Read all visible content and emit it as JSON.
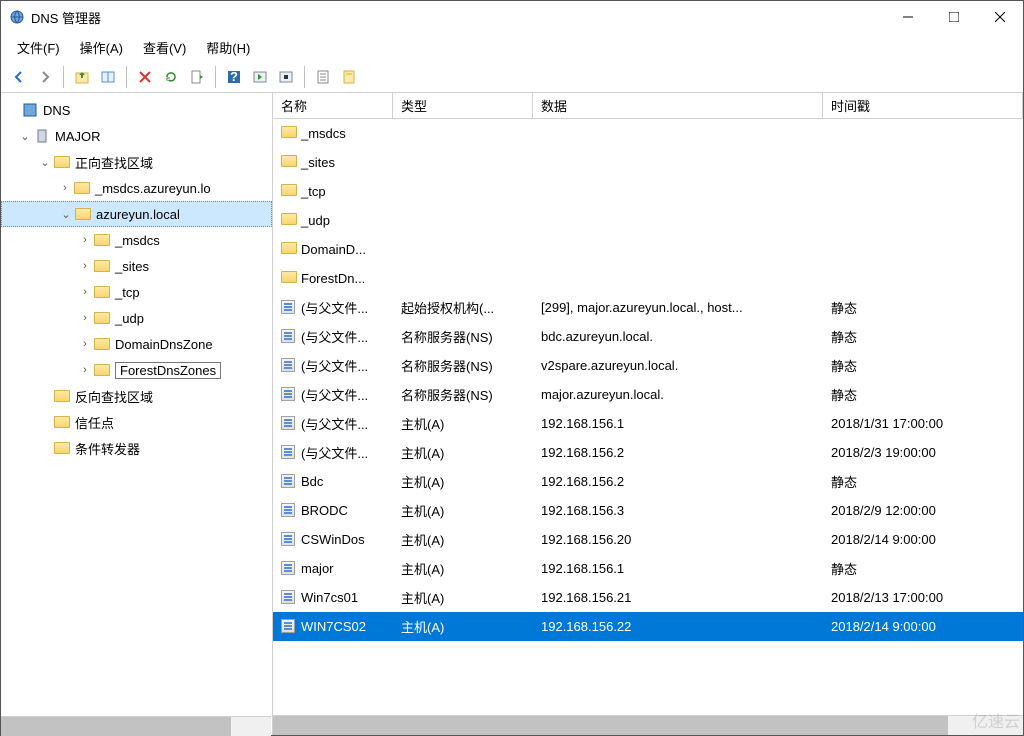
{
  "window": {
    "title": "DNS 管理器"
  },
  "menus": {
    "file": "文件(F)",
    "action": "操作(A)",
    "view": "查看(V)",
    "help": "帮助(H)"
  },
  "tree": {
    "root": "DNS",
    "server": "MAJOR",
    "fwd_zone": "正向查找区域",
    "rev_zone": "反向查找区域",
    "trust": "信任点",
    "cond_fwd": "条件转发器",
    "zone_msdcs": "_msdcs.azureyun.lo",
    "zone_local": "azureyun.local",
    "sub_msdcs": "_msdcs",
    "sub_sites": "_sites",
    "sub_tcp": "_tcp",
    "sub_udp": "_udp",
    "sub_domaindns": "DomainDnsZone",
    "sub_forestdns": "ForestDnsZones"
  },
  "columns": {
    "name": "名称",
    "type": "类型",
    "data": "数据",
    "ts": "时间戳"
  },
  "col_widths": {
    "name": "120px",
    "type": "140px",
    "data": "290px",
    "ts": "200px"
  },
  "rows": [
    {
      "icon": "folder",
      "name": "_msdcs",
      "type": "",
      "data": "",
      "ts": ""
    },
    {
      "icon": "folder",
      "name": "_sites",
      "type": "",
      "data": "",
      "ts": ""
    },
    {
      "icon": "folder",
      "name": "_tcp",
      "type": "",
      "data": "",
      "ts": ""
    },
    {
      "icon": "folder",
      "name": "_udp",
      "type": "",
      "data": "",
      "ts": ""
    },
    {
      "icon": "folder",
      "name": "DomainD...",
      "type": "",
      "data": "",
      "ts": ""
    },
    {
      "icon": "folder",
      "name": "ForestDn...",
      "type": "",
      "data": "",
      "ts": ""
    },
    {
      "icon": "rec",
      "name": "(与父文件...",
      "type": "起始授权机构(...",
      "data": "[299], major.azureyun.local., host...",
      "ts": "静态"
    },
    {
      "icon": "rec",
      "name": "(与父文件...",
      "type": "名称服务器(NS)",
      "data": "bdc.azureyun.local.",
      "ts": "静态"
    },
    {
      "icon": "rec",
      "name": "(与父文件...",
      "type": "名称服务器(NS)",
      "data": "v2spare.azureyun.local.",
      "ts": "静态"
    },
    {
      "icon": "rec",
      "name": "(与父文件...",
      "type": "名称服务器(NS)",
      "data": "major.azureyun.local.",
      "ts": "静态"
    },
    {
      "icon": "rec",
      "name": "(与父文件...",
      "type": "主机(A)",
      "data": "192.168.156.1",
      "ts": "2018/1/31 17:00:00"
    },
    {
      "icon": "rec",
      "name": "(与父文件...",
      "type": "主机(A)",
      "data": "192.168.156.2",
      "ts": "2018/2/3 19:00:00"
    },
    {
      "icon": "rec",
      "name": "Bdc",
      "type": "主机(A)",
      "data": "192.168.156.2",
      "ts": "静态"
    },
    {
      "icon": "rec",
      "name": "BRODC",
      "type": "主机(A)",
      "data": "192.168.156.3",
      "ts": "2018/2/9 12:00:00"
    },
    {
      "icon": "rec",
      "name": "CSWinDos",
      "type": "主机(A)",
      "data": "192.168.156.20",
      "ts": "2018/2/14 9:00:00"
    },
    {
      "icon": "rec",
      "name": "major",
      "type": "主机(A)",
      "data": "192.168.156.1",
      "ts": "静态"
    },
    {
      "icon": "rec",
      "name": "Win7cs01",
      "type": "主机(A)",
      "data": "192.168.156.21",
      "ts": "2018/2/13 17:00:00"
    },
    {
      "icon": "rec",
      "name": "WIN7CS02",
      "type": "主机(A)",
      "data": "192.168.156.22",
      "ts": "2018/2/14 9:00:00",
      "selected": true
    }
  ],
  "watermark": "亿速云"
}
